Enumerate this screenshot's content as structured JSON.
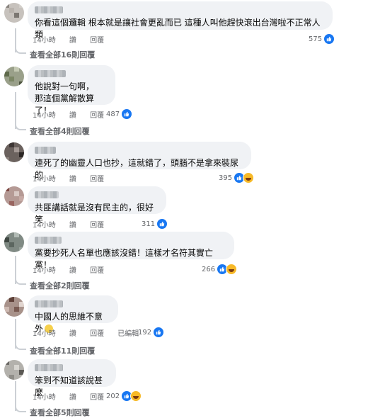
{
  "comments": [
    {
      "text": "你看這個邏輯 根本就是讓社會更亂而已 這種人叫他趕快滾出台灣啦不正常人類",
      "time": "14小時",
      "like": "讚",
      "reply": "回覆",
      "edited": "",
      "reaction_count": "575",
      "reactions": [
        "like-icon"
      ],
      "view_replies": "查看全部16則回覆"
    },
    {
      "text": "他說對一句啊，\n那這個黨解散算了！",
      "time": "14小時",
      "like": "讚",
      "reply": "回覆",
      "edited": "",
      "reaction_count": "487",
      "reactions": [
        "like-icon"
      ],
      "view_replies": "查看全部4則回覆"
    },
    {
      "text": "連死了的幽靈人口也抄，這就錯了，頭腦不是拿來裝尿的",
      "time": "14小時",
      "like": "讚",
      "reply": "回覆",
      "edited": "",
      "reaction_count": "395",
      "reactions": [
        "like-icon",
        "haha-icon"
      ],
      "view_replies": ""
    },
    {
      "text": "共匪講話就是沒有民主的，很好笑",
      "time": "14小時",
      "like": "讚",
      "reply": "回覆",
      "edited": "",
      "reaction_count": "311",
      "reactions": [
        "like-icon"
      ],
      "view_replies": ""
    },
    {
      "text": "黨要抄死人名單也應該沒錯！這樣才名符其實亡黨！",
      "time": "14小時",
      "like": "讚",
      "reply": "回覆",
      "edited": "",
      "reaction_count": "266",
      "reactions": [
        "like-icon",
        "haha-icon"
      ],
      "view_replies": "查看全部2則回覆"
    },
    {
      "text": "中國人的思維不意外",
      "time": "14小時",
      "like": "讚",
      "reply": "回覆",
      "edited": "已編輯",
      "reaction_count": "192",
      "reactions": [
        "like-icon"
      ],
      "view_replies": "查看全部11則回覆"
    },
    {
      "text": "笨到不知道該說甚麼",
      "time": "14小時",
      "like": "讚",
      "reply": "回覆",
      "edited": "",
      "reaction_count": "202",
      "reactions": [
        "like-icon",
        "haha-icon"
      ],
      "view_replies": "查看全部5則回覆"
    }
  ],
  "colors": {
    "bubble": "#f0f2f5",
    "meta": "#65676b",
    "like": "#1877f2",
    "haha": "#f7b928"
  }
}
